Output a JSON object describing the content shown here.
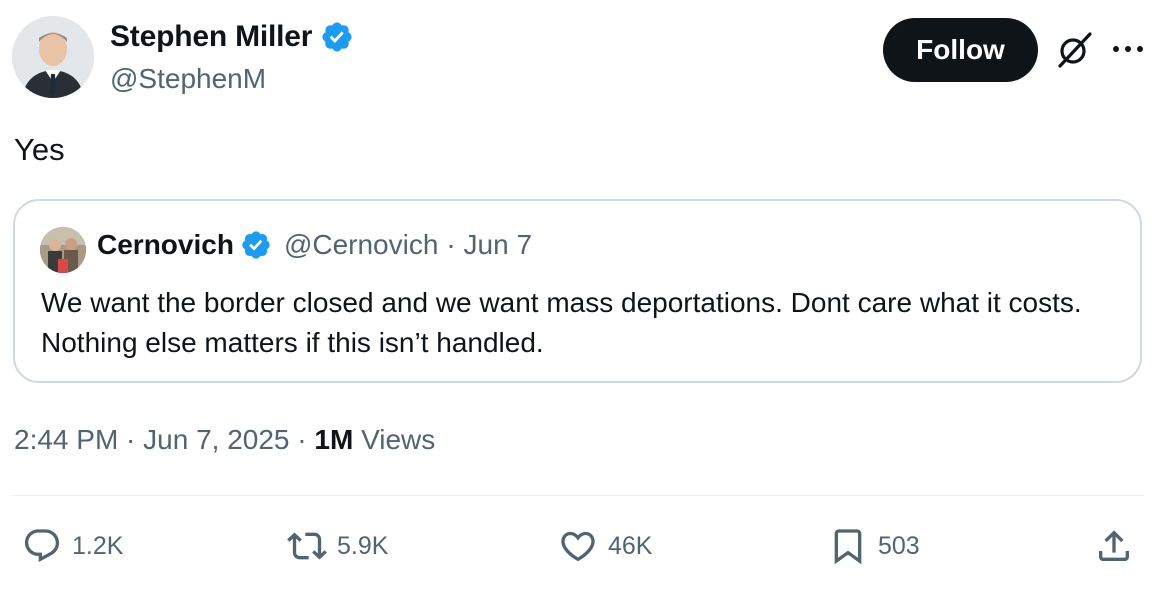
{
  "author": {
    "name": "Stephen Miller",
    "handle": "@StephenM",
    "verified_color": "#1d9bf0"
  },
  "follow_label": "Follow",
  "tweet": {
    "text": "Yes",
    "timestamp": "2:44 PM · Jun 7, 2025 · ",
    "views_count": "1M",
    "views_label": " Views"
  },
  "quoted": {
    "name": "Cernovich",
    "handle": "@Cernovich",
    "date": "· Jun 7",
    "text": "We want the border closed and we want mass deportations. Dont care what it costs. Nothing else matters if this isn’t handled."
  },
  "actions": {
    "replies": "1.2K",
    "reposts": "5.9K",
    "likes": "46K",
    "bookmarks": "503"
  },
  "icons": {
    "reply": "reply-icon",
    "repost": "repost-icon",
    "like": "like-icon",
    "bookmark": "bookmark-icon",
    "share": "share-icon",
    "grok": "grok-icon",
    "more": "more-icon",
    "verified": "verified-badge-icon"
  }
}
